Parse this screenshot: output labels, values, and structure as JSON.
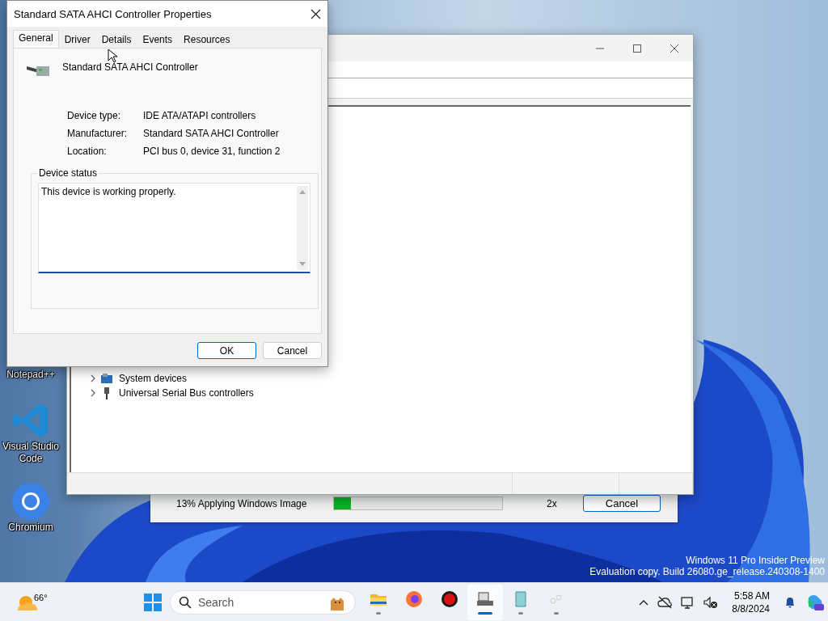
{
  "desktop_icons": [
    {
      "label": "Notepad++"
    },
    {
      "kind": "vscode",
      "label": "Visual Studio Code"
    },
    {
      "kind": "chromium",
      "label": "Chromium"
    }
  ],
  "setup_progress": {
    "status": "13% Applying Windows Image",
    "level": 0.1,
    "speed": "2x",
    "cancel_button": "Cancel"
  },
  "device_manager": {
    "tree_items": [
      {
        "kind": "system",
        "label": "System devices",
        "expanded": false
      },
      {
        "kind": "usb",
        "label": "Universal Serial Bus controllers",
        "expanded": false
      }
    ]
  },
  "properties_dialog": {
    "title": "Standard SATA AHCI Controller Properties",
    "tabs": [
      {
        "label": "General",
        "selected": true
      },
      {
        "label": "Driver",
        "selected": false
      },
      {
        "label": "Details",
        "selected": false
      },
      {
        "label": "Events",
        "selected": false
      },
      {
        "label": "Resources",
        "selected": false
      }
    ],
    "device_name": "Standard SATA AHCI Controller",
    "properties": [
      {
        "label": "Device type:",
        "value": "IDE ATA/ATAPI controllers"
      },
      {
        "label": "Manufacturer:",
        "value": "Standard SATA AHCI Controller"
      },
      {
        "label": "Location:",
        "value": "PCI bus 0, device 31, function 2"
      }
    ],
    "status_group": "Device status",
    "status_text": "This device is working properly.",
    "buttons": [
      {
        "kind": "default",
        "label": "OK"
      },
      {
        "kind": "normal",
        "label": "Cancel"
      }
    ]
  },
  "watermark": [
    "Windows 11 Pro Insider Preview",
    "Evaluation copy. Build 26080.ge_release.240308-1400"
  ],
  "taskbar": {
    "weather_temp": "66°",
    "search_placeholder": "Search",
    "apps": [
      {
        "kind": "folder",
        "running": true,
        "active": false
      },
      {
        "kind": "firefox",
        "running": false,
        "active": false
      },
      {
        "kind": "redapp",
        "running": false,
        "active": false
      },
      {
        "kind": "devmgr",
        "running": true,
        "active": true
      },
      {
        "kind": "setup",
        "running": true,
        "active": false
      },
      {
        "kind": "faint",
        "running": true,
        "active": false
      }
    ],
    "time": "5:58 AM",
    "date": "8/8/2024"
  }
}
